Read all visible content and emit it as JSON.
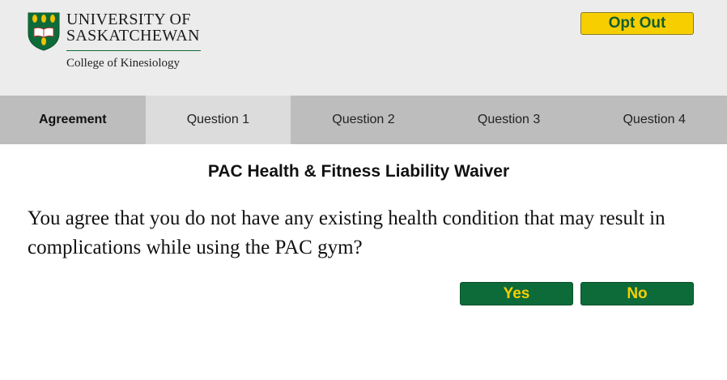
{
  "header": {
    "logo_line1": "UNIVERSITY OF",
    "logo_line2": "SASKATCHEWAN",
    "college": "College of Kinesiology",
    "opt_out_label": "Opt Out"
  },
  "tabs": [
    {
      "label": "Agreement"
    },
    {
      "label": "Question 1"
    },
    {
      "label": "Question 2"
    },
    {
      "label": "Question 3"
    },
    {
      "label": "Question 4"
    }
  ],
  "main": {
    "title": "PAC Health & Fitness Liability Waiver",
    "question": "You agree that you do not have any existing health condition that may result in complications while using the PAC gym?",
    "yes_label": "Yes",
    "no_label": "No"
  },
  "colors": {
    "brand_green": "#0d6b3a",
    "brand_yellow": "#f7cf00",
    "header_bg": "#ececec",
    "tab_bg": "#bdbdbd",
    "tab_active_bg": "#dcdcdc"
  }
}
